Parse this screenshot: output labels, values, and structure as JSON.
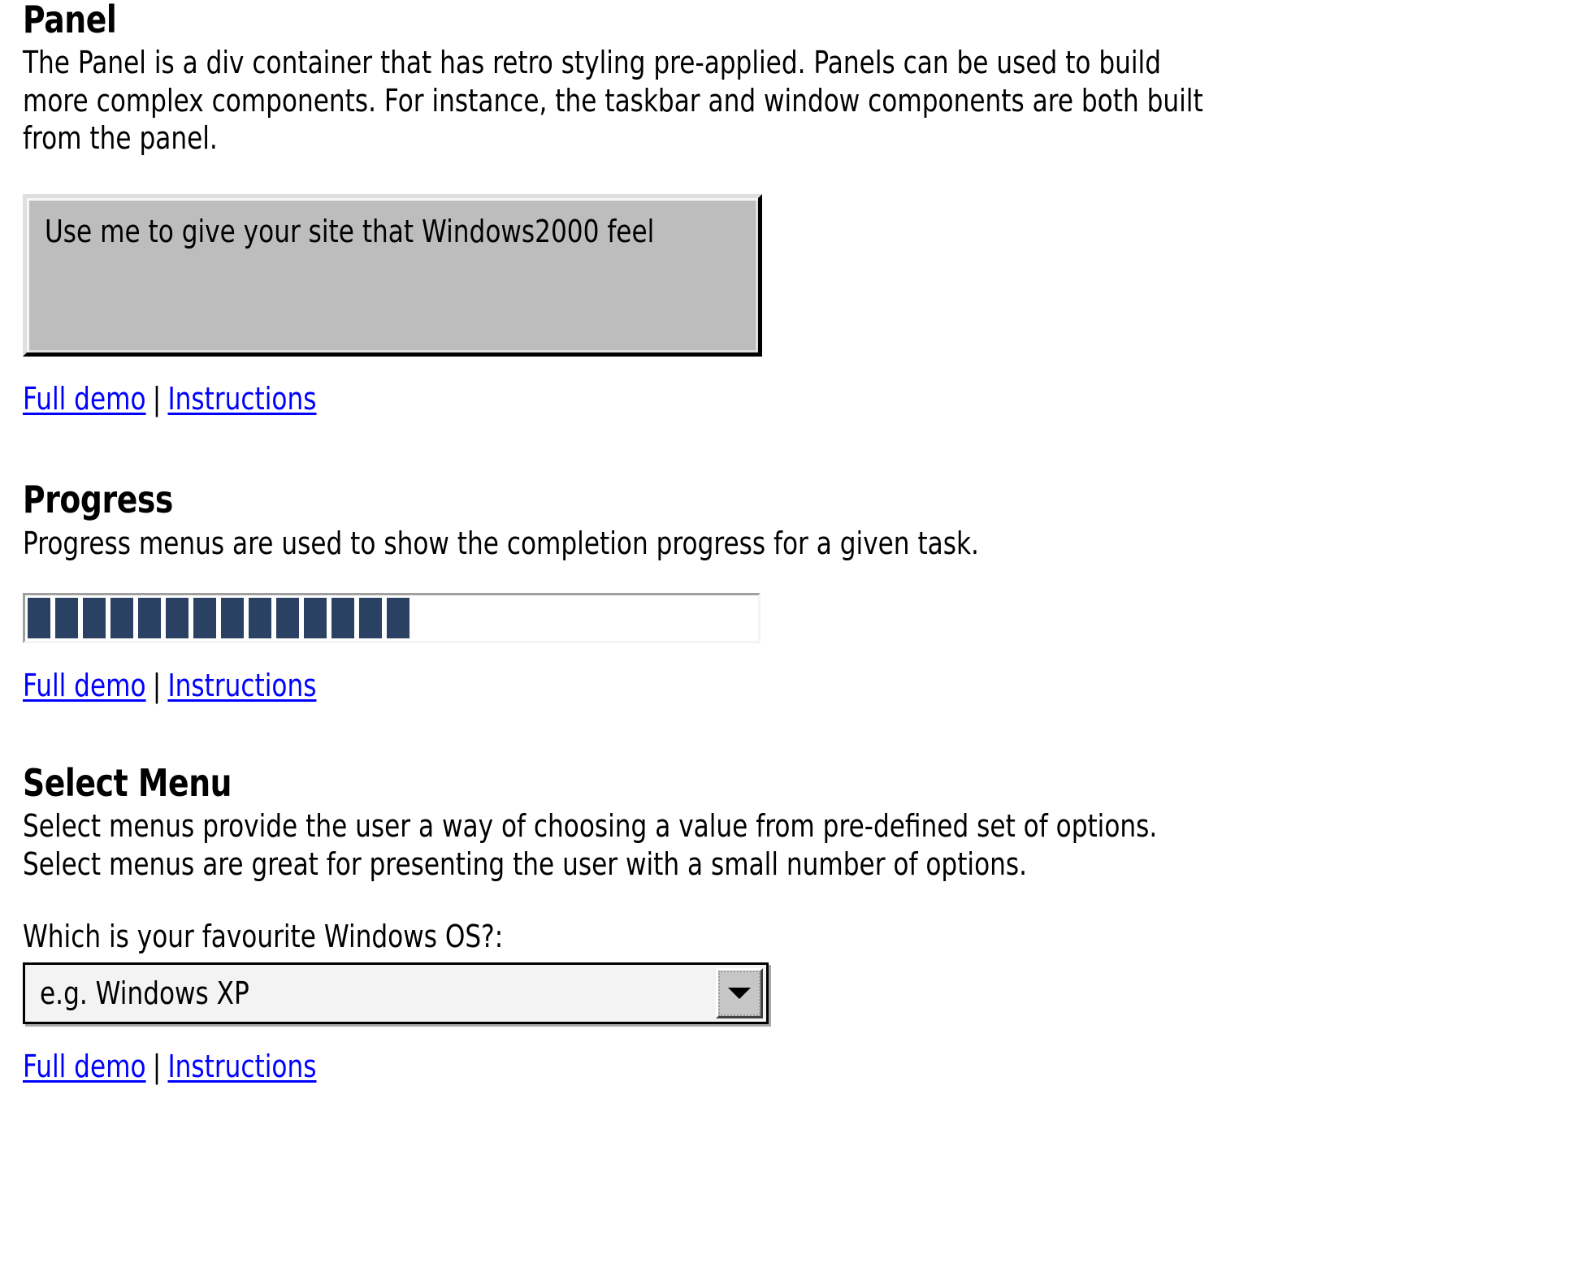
{
  "sections": [
    {
      "id": "panel",
      "title": "Panel",
      "description": "The Panel is a div container that has retro styling pre-applied. Panels can be used to build more complex components. For instance, the taskbar and window components are both built from the panel.",
      "panel_text": "Use me to give your site that Windows2000 feel",
      "links": {
        "demo_label": "Full demo",
        "separator": "|",
        "instructions_label": "Instructions"
      }
    },
    {
      "id": "progress",
      "title": "Progress",
      "description": "Progress menus are used to show the completion progress for a given task.",
      "progress": {
        "blocks_filled": 14,
        "total_slots": 26,
        "fill_color": "#2b4163",
        "track_color": "#ffffff"
      },
      "links": {
        "demo_label": "Full demo",
        "separator": "|",
        "instructions_label": "Instructions"
      }
    },
    {
      "id": "select-menu",
      "title": "Select Menu",
      "description": "Select menus provide the user a way of choosing a value from pre-defined set of options. Select menus are great for presenting the user with a small number of options.",
      "select": {
        "label": "Which is your favourite Windows OS?:",
        "value": "e.g. Windows XP",
        "arrow_icon": "chevron-down-icon"
      },
      "links": {
        "demo_label": "Full demo",
        "separator": "|",
        "instructions_label": "Instructions"
      }
    }
  ],
  "theme": {
    "background": "#ffffff",
    "text": "#000000",
    "link": "#0000ff",
    "panel_face": "#bdbdbd",
    "panel_highlight": "#dfdfdf",
    "panel_shadow": "#000000",
    "control_face": "#c6c6c6",
    "field_background": "#f3f3f3"
  }
}
